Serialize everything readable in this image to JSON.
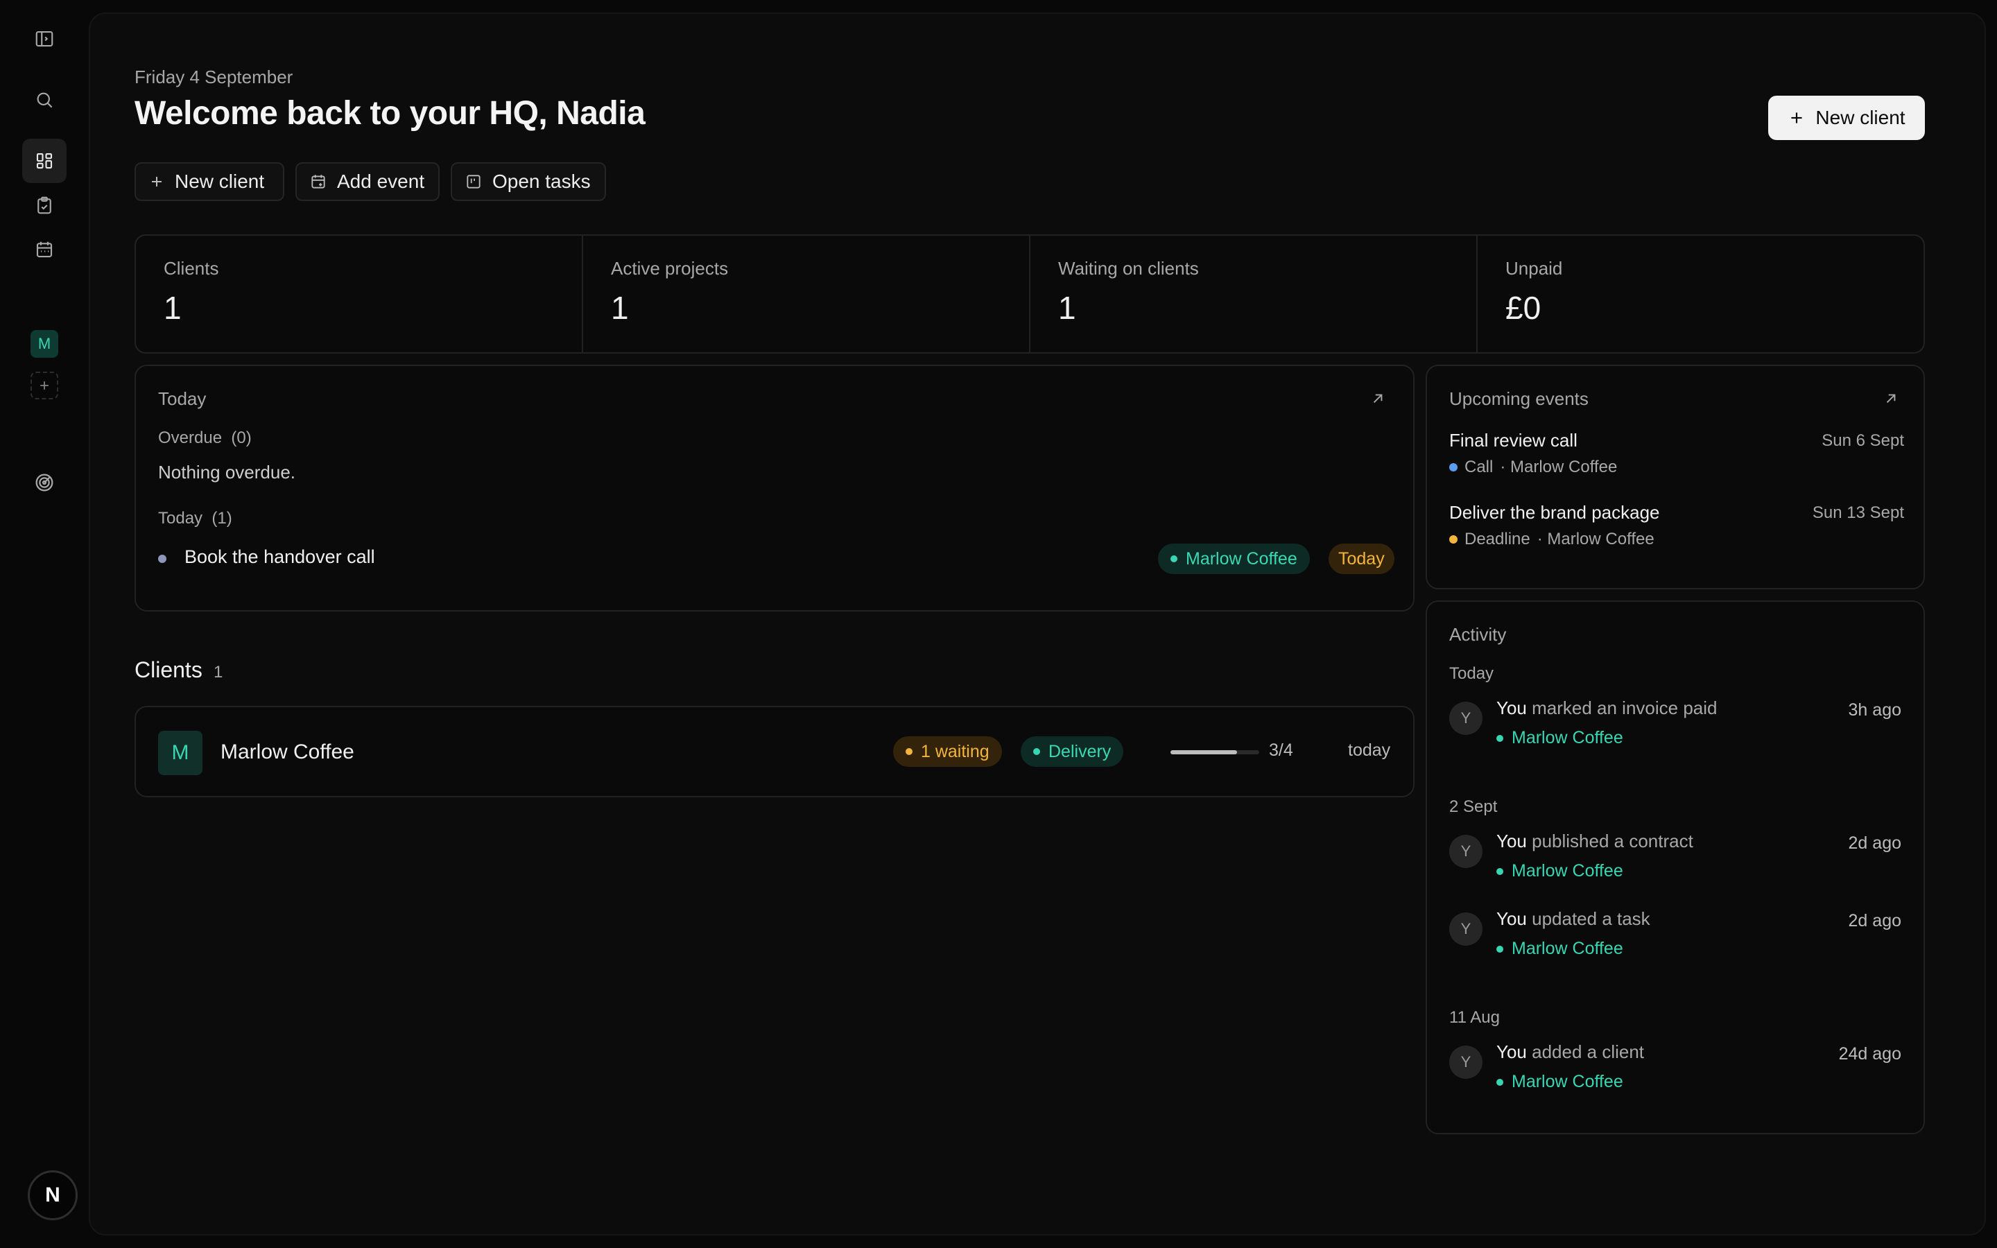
{
  "sidebar": {
    "workspace_initial": "M",
    "user_initial": "N",
    "icons": [
      "sidebar-toggle-icon",
      "search-icon",
      "dashboard-icon",
      "clipboard-check-icon",
      "calendar-icon",
      "plus-icon",
      "radar-icon"
    ]
  },
  "header": {
    "date": "Friday 4 September",
    "title": "Welcome back to your HQ, Nadia",
    "primary_button": "New client"
  },
  "quick_actions": [
    {
      "label": "New client",
      "icon": "plus-icon"
    },
    {
      "label": "Add event",
      "icon": "calendar-plus-icon"
    },
    {
      "label": "Open tasks",
      "icon": "board-icon"
    }
  ],
  "stats": [
    {
      "label": "Clients",
      "value": "1"
    },
    {
      "label": "Active projects",
      "value": "1"
    },
    {
      "label": "Waiting on clients",
      "value": "1"
    },
    {
      "label": "Unpaid",
      "value": "£0"
    }
  ],
  "today": {
    "title": "Today",
    "overdue_label": "Overdue",
    "overdue_count": "(0)",
    "overdue_empty": "Nothing overdue.",
    "today_label": "Today",
    "today_count": "(1)",
    "tasks": [
      {
        "title": "Book the handover call",
        "client": "Marlow Coffee",
        "due": "Today"
      }
    ]
  },
  "clients": {
    "heading": "Clients",
    "count": "1",
    "rows": [
      {
        "initial": "M",
        "name": "Marlow Coffee",
        "waiting": "1 waiting",
        "stage": "Delivery",
        "progress": 0.75,
        "progress_text": "3/4",
        "updated": "today"
      }
    ]
  },
  "events": {
    "title": "Upcoming events",
    "items": [
      {
        "title": "Final review call",
        "date": "Sun 6 Sept",
        "type": "Call",
        "client": "· Marlow Coffee",
        "color": "#5b9cf0"
      },
      {
        "title": "Deliver the brand package",
        "date": "Sun 13 Sept",
        "type": "Deadline",
        "client": "· Marlow Coffee",
        "color": "#f3b53b"
      }
    ]
  },
  "activity": {
    "title": "Activity",
    "groups": [
      {
        "label": "Today",
        "items": [
          {
            "avatar": "Y",
            "actor": "You",
            "action": "marked an invoice paid",
            "client": "Marlow Coffee",
            "time": "3h ago"
          }
        ]
      },
      {
        "label": "2 Sept",
        "items": [
          {
            "avatar": "Y",
            "actor": "You",
            "action": "published a contract",
            "client": "Marlow Coffee",
            "time": "2d ago"
          },
          {
            "avatar": "Y",
            "actor": "You",
            "action": "updated a task",
            "client": "Marlow Coffee",
            "time": "2d ago"
          }
        ]
      },
      {
        "label": "11 Aug",
        "items": [
          {
            "avatar": "Y",
            "actor": "You",
            "action": "added a client",
            "client": "Marlow Coffee",
            "time": "24d ago"
          }
        ]
      }
    ]
  },
  "colors": {
    "accent_teal": "#38d6b2",
    "accent_amber": "#f3b53b",
    "call_blue": "#5b9cf0"
  }
}
